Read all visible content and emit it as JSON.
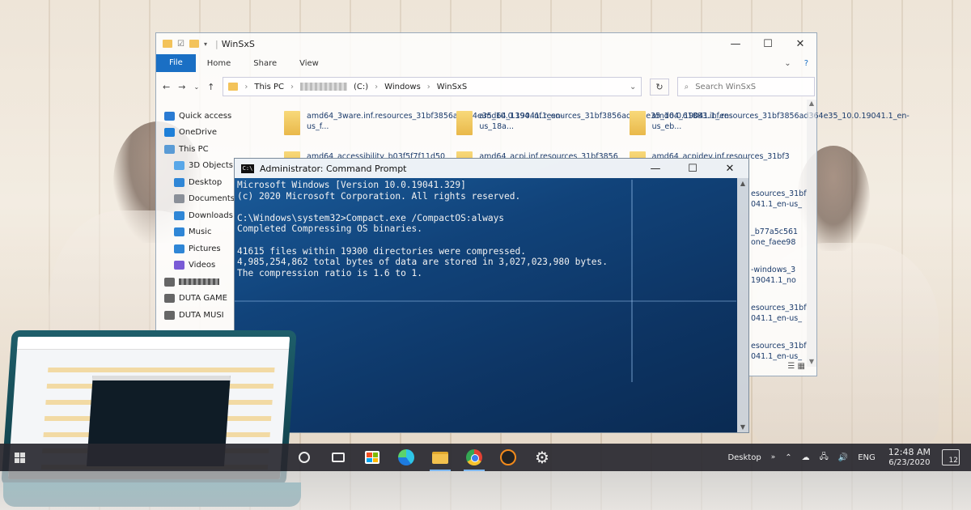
{
  "explorer": {
    "title": "WinSxS",
    "ribbon_tabs": [
      "File",
      "Home",
      "Share",
      "View"
    ],
    "breadcrumb": [
      "This PC",
      "(C:)",
      "Windows",
      "WinSxS"
    ],
    "search_placeholder": "Search WinSxS",
    "nav": [
      {
        "label": "Quick access",
        "icon": "star-icon",
        "color": "#2a7bd3"
      },
      {
        "label": "OneDrive",
        "icon": "cloud-icon",
        "color": "#1e7fd8"
      },
      {
        "label": "This PC",
        "icon": "computer-icon",
        "color": "#5a9bd5"
      },
      {
        "label": "3D Objects",
        "icon": "cube-icon",
        "color": "#59a7e8"
      },
      {
        "label": "Desktop",
        "icon": "desktop-icon",
        "color": "#2f86d6"
      },
      {
        "label": "Documents",
        "icon": "document-icon",
        "color": "#8a8f98"
      },
      {
        "label": "Downloads",
        "icon": "download-icon",
        "color": "#2f86d6"
      },
      {
        "label": "Music",
        "icon": "music-icon",
        "color": "#2f86d6"
      },
      {
        "label": "Pictures",
        "icon": "picture-icon",
        "color": "#2f86d6"
      },
      {
        "label": "Videos",
        "icon": "video-icon",
        "color": "#7a5bd6"
      },
      {
        "label": "",
        "icon": "drive-icon",
        "color": "#666666"
      },
      {
        "label": "DUTA GAME",
        "icon": "drive-icon",
        "color": "#666666"
      },
      {
        "label": "DUTA MUSI",
        "icon": "drive-icon",
        "color": "#666666"
      }
    ],
    "files": [
      [
        "amd64_3ware.inf.resources_31bf3856ad364e35_10.0.19041.1_en-us_f...",
        "amd64_1394.inf.resources_31bf3856ad364e35_10.0.19041.1_en-us_18a...",
        "amd64_61883.inf.resources_31bf3856ad364e35_10.0.19041.1_en-us_eb..."
      ],
      [
        "amd64_accessibility_b03f5f7f11d50",
        "amd64_acpi.inf.resources_31bf3856",
        "amd64_acpidev.inf.resources_31bf3"
      ]
    ],
    "right_column": [
      [
        "esources_31bf",
        "041.1_en-us_"
      ],
      [
        "_b77a5c561",
        "one_faee98"
      ],
      [
        "-windows_3",
        "19041.1_no"
      ],
      [
        "esources_31bf",
        "041.1_en-us_"
      ],
      [
        "esources_31bf",
        "041.1_en-us_"
      ]
    ]
  },
  "cmd": {
    "title": "Administrator: Command Prompt",
    "lines": [
      "Microsoft Windows [Version 10.0.19041.329]",
      "(c) 2020 Microsoft Corporation. All rights reserved.",
      "",
      "C:\\Windows\\system32>Compact.exe /CompactOS:always",
      "Completed Compressing OS binaries.",
      "",
      "41615 files within 19300 directories were compressed.",
      "4,985,254,862 total bytes of data are stored in 3,027,023,980 bytes.",
      "The compression ratio is 1.6 to 1."
    ]
  },
  "taskbar": {
    "apps": [
      "cortana-circle-icon",
      "task-view-icon",
      "store-icon",
      "edge-icon",
      "file-explorer-icon",
      "chrome-icon",
      "app-icon",
      "settings-icon"
    ],
    "desktop_label": "Desktop",
    "lang": "ENG",
    "time": "12:48 AM",
    "date": "6/23/2020",
    "notifications": "12"
  }
}
